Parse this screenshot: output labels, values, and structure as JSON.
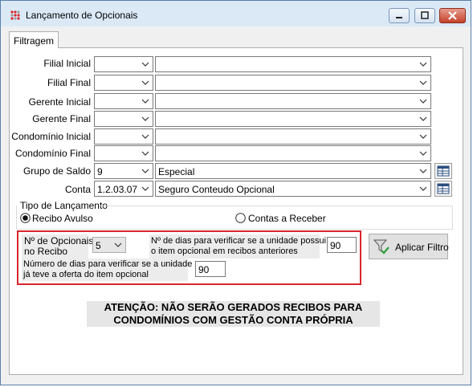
{
  "window": {
    "title": "Lançamento de Opcionais"
  },
  "tabs": [
    {
      "label": "Filtragem"
    }
  ],
  "filters": {
    "filial_inicial": {
      "label": "Filial Inicial",
      "code": "",
      "desc": ""
    },
    "filial_final": {
      "label": "Filial Final",
      "code": "",
      "desc": ""
    },
    "gerente_inicial": {
      "label": "Gerente Inicial",
      "code": "",
      "desc": ""
    },
    "gerente_final": {
      "label": "Gerente Final",
      "code": "",
      "desc": ""
    },
    "condominio_inicial": {
      "label": "Condomínio Inicial",
      "code": "",
      "desc": ""
    },
    "condominio_final": {
      "label": "Condomínio Final",
      "code": "",
      "desc": ""
    },
    "grupo_saldo": {
      "label": "Grupo de Saldo",
      "code": "9",
      "desc": "Especial"
    },
    "conta": {
      "label": "Conta",
      "code": "1.2.03.07",
      "desc": "Seguro Conteudo Opcional"
    }
  },
  "tipo_lancamento": {
    "label": "Tipo de Lançamento",
    "options": [
      {
        "label": "Recibo Avulso",
        "checked": true
      },
      {
        "label": "Contas a Receber",
        "checked": false
      }
    ]
  },
  "opcionais": {
    "n_opcionais_label_1": "Nº de Opcionais",
    "n_opcionais_label_2": "no Recibo",
    "n_opcionais_value": "5",
    "dias_unidade_label_1": "Nº de dias para verificar se a unidade possui",
    "dias_unidade_label_2": "o item opcional em recibos anteriores",
    "dias_unidade_value": "90",
    "dias_oferta_label_1": "Número de dias para verificar se a unidade",
    "dias_oferta_label_2": "já teve a oferta do item opcional",
    "dias_oferta_value": "90"
  },
  "buttons": {
    "aplicar_filtro": "Aplicar Filtro"
  },
  "warning": {
    "line1": "ATENÇÃO: NÃO SERÃO GERADOS RECIBOS PARA",
    "line2": "CONDOMÍNIOS COM GESTÃO CONTA PRÓPRIA"
  },
  "colors": {
    "highlight_border": "#d9262c",
    "title_bar": "#dbe9f7",
    "close_button": "#c4422b"
  }
}
